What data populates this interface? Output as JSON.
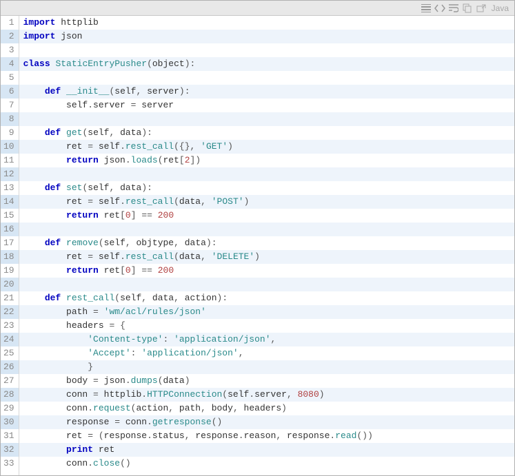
{
  "toolbar": {
    "lang_label": "Java"
  },
  "code": {
    "language": "python",
    "highlight_mod": 2,
    "lines": [
      [
        [
          "kw",
          "import"
        ],
        [
          "id",
          " httplib"
        ]
      ],
      [
        [
          "kw",
          "import"
        ],
        [
          "id",
          " json"
        ]
      ],
      [],
      [
        [
          "kw",
          "class"
        ],
        [
          "id",
          " "
        ],
        [
          "fn",
          "StaticEntryPusher"
        ],
        [
          "pun",
          "("
        ],
        [
          "id",
          "object"
        ],
        [
          "pun",
          ")"
        ],
        [
          "op",
          ":"
        ]
      ],
      [],
      [
        [
          "id",
          "    "
        ],
        [
          "kw",
          "def"
        ],
        [
          "id",
          " "
        ],
        [
          "fn",
          "__init__"
        ],
        [
          "pun",
          "("
        ],
        [
          "id",
          "self"
        ],
        [
          "pun",
          ","
        ],
        [
          "id",
          " server"
        ],
        [
          "pun",
          ")"
        ],
        [
          "op",
          ":"
        ]
      ],
      [
        [
          "id",
          "        self"
        ],
        [
          "op",
          "."
        ],
        [
          "id",
          "server "
        ],
        [
          "op",
          "="
        ],
        [
          "id",
          " server"
        ]
      ],
      [],
      [
        [
          "id",
          "    "
        ],
        [
          "kw",
          "def"
        ],
        [
          "id",
          " "
        ],
        [
          "fn",
          "get"
        ],
        [
          "pun",
          "("
        ],
        [
          "id",
          "self"
        ],
        [
          "pun",
          ","
        ],
        [
          "id",
          " data"
        ],
        [
          "pun",
          ")"
        ],
        [
          "op",
          ":"
        ]
      ],
      [
        [
          "id",
          "        ret "
        ],
        [
          "op",
          "="
        ],
        [
          "id",
          " self"
        ],
        [
          "op",
          "."
        ],
        [
          "fn",
          "rest_call"
        ],
        [
          "pun",
          "("
        ],
        [
          "pun",
          "{"
        ],
        [
          "pun",
          "}"
        ],
        [
          "pun",
          ","
        ],
        [
          "id",
          " "
        ],
        [
          "str",
          "'GET'"
        ],
        [
          "pun",
          ")"
        ]
      ],
      [
        [
          "id",
          "        "
        ],
        [
          "kw",
          "return"
        ],
        [
          "id",
          " json"
        ],
        [
          "op",
          "."
        ],
        [
          "fn",
          "loads"
        ],
        [
          "pun",
          "("
        ],
        [
          "id",
          "ret"
        ],
        [
          "pun",
          "["
        ],
        [
          "num",
          "2"
        ],
        [
          "pun",
          "]"
        ],
        [
          "pun",
          ")"
        ]
      ],
      [],
      [
        [
          "id",
          "    "
        ],
        [
          "kw",
          "def"
        ],
        [
          "id",
          " "
        ],
        [
          "fn",
          "set"
        ],
        [
          "pun",
          "("
        ],
        [
          "id",
          "self"
        ],
        [
          "pun",
          ","
        ],
        [
          "id",
          " data"
        ],
        [
          "pun",
          ")"
        ],
        [
          "op",
          ":"
        ]
      ],
      [
        [
          "id",
          "        ret "
        ],
        [
          "op",
          "="
        ],
        [
          "id",
          " self"
        ],
        [
          "op",
          "."
        ],
        [
          "fn",
          "rest_call"
        ],
        [
          "pun",
          "("
        ],
        [
          "id",
          "data"
        ],
        [
          "pun",
          ","
        ],
        [
          "id",
          " "
        ],
        [
          "str",
          "'POST'"
        ],
        [
          "pun",
          ")"
        ]
      ],
      [
        [
          "id",
          "        "
        ],
        [
          "kw",
          "return"
        ],
        [
          "id",
          " ret"
        ],
        [
          "pun",
          "["
        ],
        [
          "num",
          "0"
        ],
        [
          "pun",
          "]"
        ],
        [
          "id",
          " "
        ],
        [
          "op",
          "=="
        ],
        [
          "id",
          " "
        ],
        [
          "num",
          "200"
        ]
      ],
      [],
      [
        [
          "id",
          "    "
        ],
        [
          "kw",
          "def"
        ],
        [
          "id",
          " "
        ],
        [
          "fn",
          "remove"
        ],
        [
          "pun",
          "("
        ],
        [
          "id",
          "self"
        ],
        [
          "pun",
          ","
        ],
        [
          "id",
          " objtype"
        ],
        [
          "pun",
          ","
        ],
        [
          "id",
          " data"
        ],
        [
          "pun",
          ")"
        ],
        [
          "op",
          ":"
        ]
      ],
      [
        [
          "id",
          "        ret "
        ],
        [
          "op",
          "="
        ],
        [
          "id",
          " self"
        ],
        [
          "op",
          "."
        ],
        [
          "fn",
          "rest_call"
        ],
        [
          "pun",
          "("
        ],
        [
          "id",
          "data"
        ],
        [
          "pun",
          ","
        ],
        [
          "id",
          " "
        ],
        [
          "str",
          "'DELETE'"
        ],
        [
          "pun",
          ")"
        ]
      ],
      [
        [
          "id",
          "        "
        ],
        [
          "kw",
          "return"
        ],
        [
          "id",
          " ret"
        ],
        [
          "pun",
          "["
        ],
        [
          "num",
          "0"
        ],
        [
          "pun",
          "]"
        ],
        [
          "id",
          " "
        ],
        [
          "op",
          "=="
        ],
        [
          "id",
          " "
        ],
        [
          "num",
          "200"
        ]
      ],
      [],
      [
        [
          "id",
          "    "
        ],
        [
          "kw",
          "def"
        ],
        [
          "id",
          " "
        ],
        [
          "fn",
          "rest_call"
        ],
        [
          "pun",
          "("
        ],
        [
          "id",
          "self"
        ],
        [
          "pun",
          ","
        ],
        [
          "id",
          " data"
        ],
        [
          "pun",
          ","
        ],
        [
          "id",
          " action"
        ],
        [
          "pun",
          ")"
        ],
        [
          "op",
          ":"
        ]
      ],
      [
        [
          "id",
          "        path "
        ],
        [
          "op",
          "="
        ],
        [
          "id",
          " "
        ],
        [
          "str",
          "'wm/acl/rules/json'"
        ]
      ],
      [
        [
          "id",
          "        headers "
        ],
        [
          "op",
          "="
        ],
        [
          "id",
          " "
        ],
        [
          "pun",
          "{"
        ]
      ],
      [
        [
          "id",
          "            "
        ],
        [
          "str",
          "'Content-type'"
        ],
        [
          "pun",
          ":"
        ],
        [
          "id",
          " "
        ],
        [
          "str",
          "'application/json'"
        ],
        [
          "pun",
          ","
        ]
      ],
      [
        [
          "id",
          "            "
        ],
        [
          "str",
          "'Accept'"
        ],
        [
          "pun",
          ":"
        ],
        [
          "id",
          " "
        ],
        [
          "str",
          "'application/json'"
        ],
        [
          "pun",
          ","
        ]
      ],
      [
        [
          "id",
          "            "
        ],
        [
          "pun",
          "}"
        ]
      ],
      [
        [
          "id",
          "        body "
        ],
        [
          "op",
          "="
        ],
        [
          "id",
          " json"
        ],
        [
          "op",
          "."
        ],
        [
          "fn",
          "dumps"
        ],
        [
          "pun",
          "("
        ],
        [
          "id",
          "data"
        ],
        [
          "pun",
          ")"
        ]
      ],
      [
        [
          "id",
          "        conn "
        ],
        [
          "op",
          "="
        ],
        [
          "id",
          " httplib"
        ],
        [
          "op",
          "."
        ],
        [
          "fn",
          "HTTPConnection"
        ],
        [
          "pun",
          "("
        ],
        [
          "id",
          "self"
        ],
        [
          "op",
          "."
        ],
        [
          "id",
          "server"
        ],
        [
          "pun",
          ","
        ],
        [
          "id",
          " "
        ],
        [
          "num",
          "8080"
        ],
        [
          "pun",
          ")"
        ]
      ],
      [
        [
          "id",
          "        conn"
        ],
        [
          "op",
          "."
        ],
        [
          "fn",
          "request"
        ],
        [
          "pun",
          "("
        ],
        [
          "id",
          "action"
        ],
        [
          "pun",
          ","
        ],
        [
          "id",
          " path"
        ],
        [
          "pun",
          ","
        ],
        [
          "id",
          " body"
        ],
        [
          "pun",
          ","
        ],
        [
          "id",
          " headers"
        ],
        [
          "pun",
          ")"
        ]
      ],
      [
        [
          "id",
          "        response "
        ],
        [
          "op",
          "="
        ],
        [
          "id",
          " conn"
        ],
        [
          "op",
          "."
        ],
        [
          "fn",
          "getresponse"
        ],
        [
          "pun",
          "("
        ],
        [
          "pun",
          ")"
        ]
      ],
      [
        [
          "id",
          "        ret "
        ],
        [
          "op",
          "="
        ],
        [
          "id",
          " "
        ],
        [
          "pun",
          "("
        ],
        [
          "id",
          "response"
        ],
        [
          "op",
          "."
        ],
        [
          "id",
          "status"
        ],
        [
          "pun",
          ","
        ],
        [
          "id",
          " response"
        ],
        [
          "op",
          "."
        ],
        [
          "id",
          "reason"
        ],
        [
          "pun",
          ","
        ],
        [
          "id",
          " response"
        ],
        [
          "op",
          "."
        ],
        [
          "fn",
          "read"
        ],
        [
          "pun",
          "("
        ],
        [
          "pun",
          ")"
        ],
        [
          "pun",
          ")"
        ]
      ],
      [
        [
          "id",
          "        "
        ],
        [
          "kw",
          "print"
        ],
        [
          "id",
          " ret"
        ]
      ],
      [
        [
          "id",
          "        conn"
        ],
        [
          "op",
          "."
        ],
        [
          "fn",
          "close"
        ],
        [
          "pun",
          "("
        ],
        [
          "pun",
          ")"
        ]
      ]
    ]
  }
}
